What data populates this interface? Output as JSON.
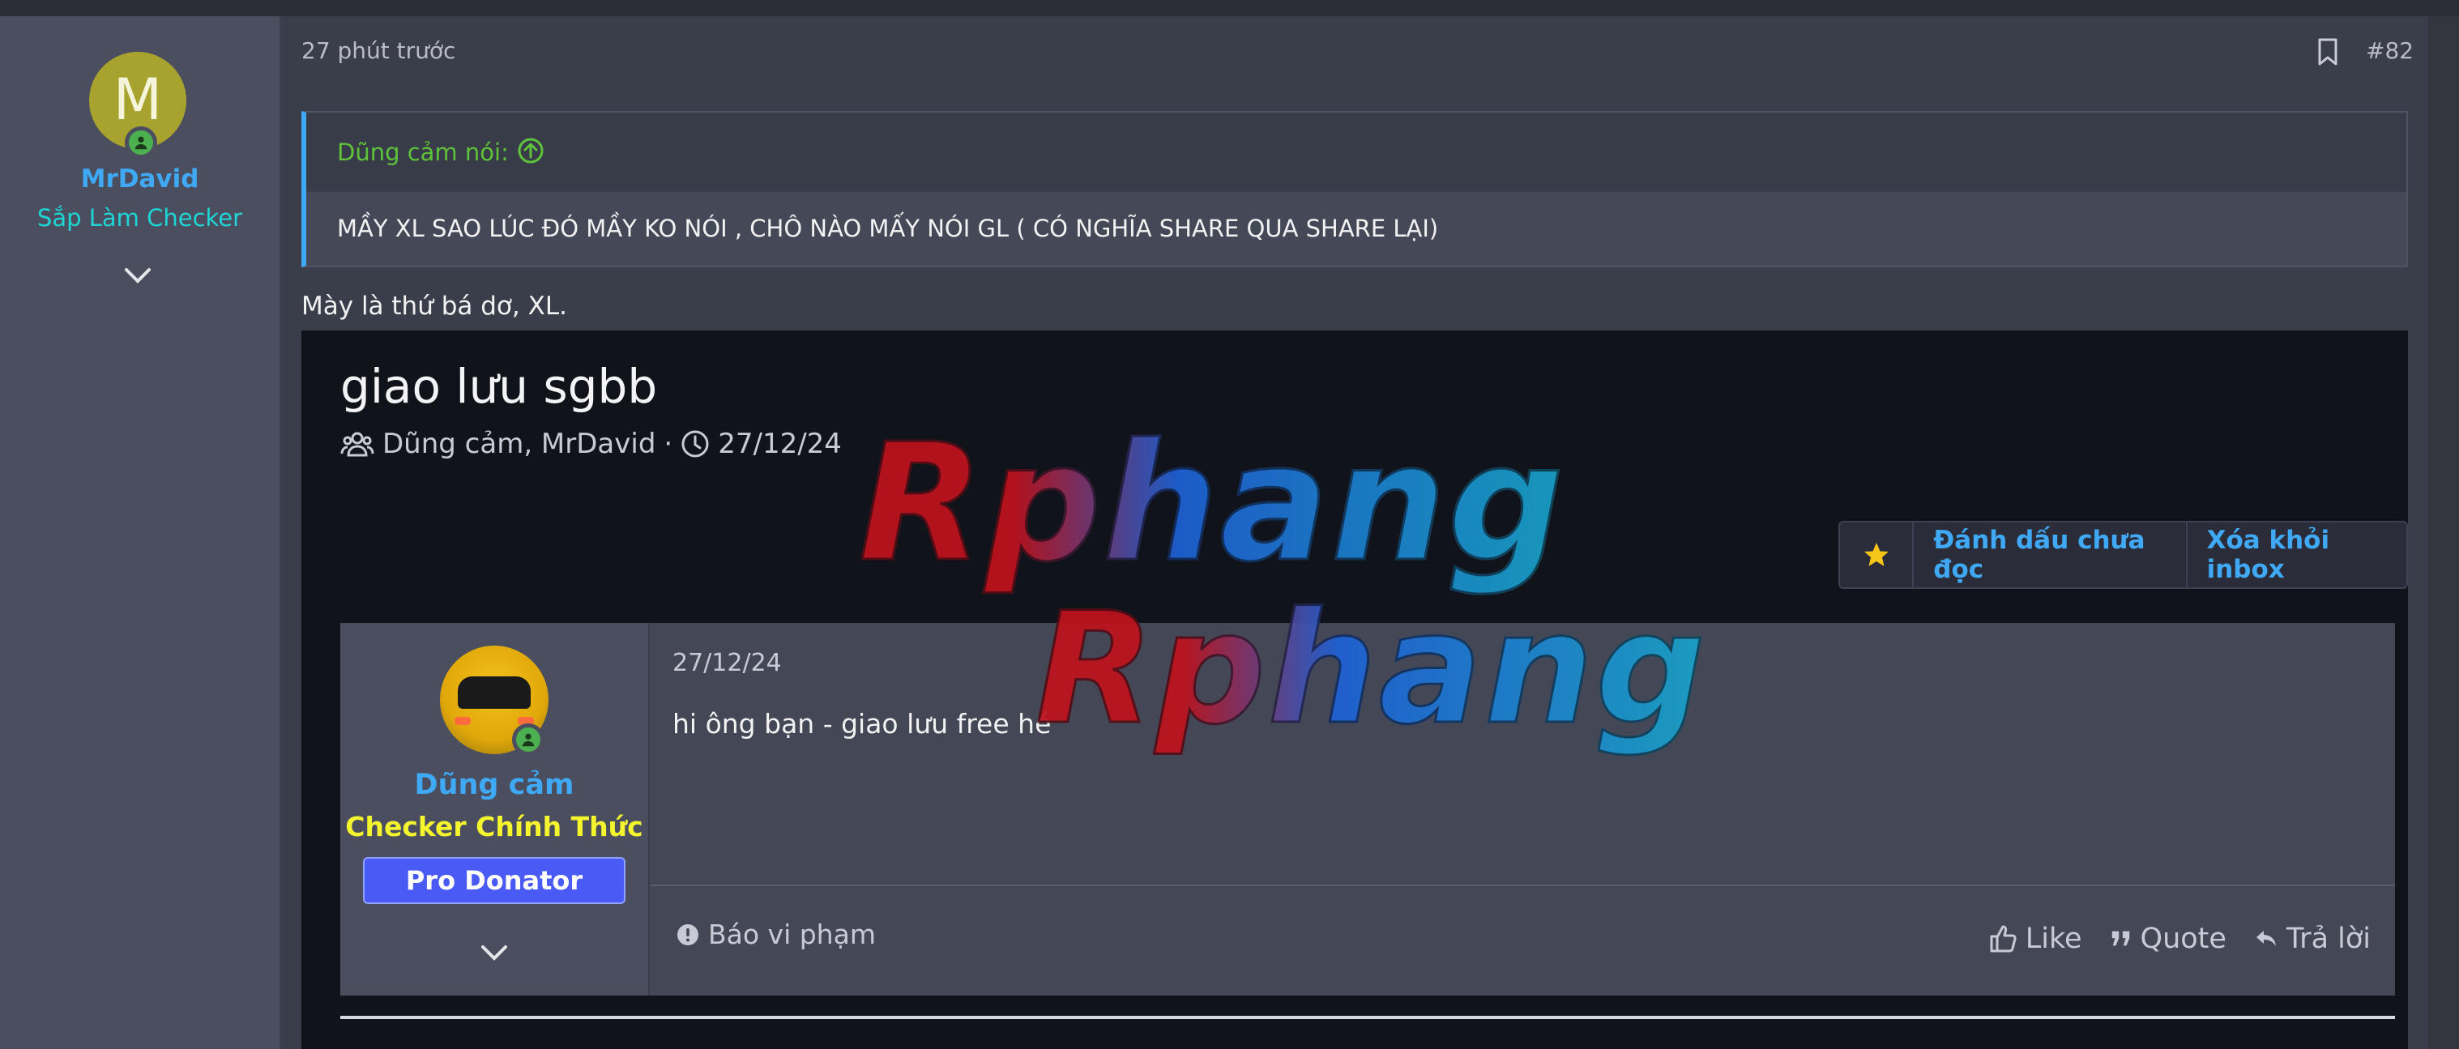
{
  "post": {
    "time": "27 phút trước",
    "number": "#82",
    "body_text": "Mày là thứ bá dơ, XL."
  },
  "author": {
    "avatar_letter": "M",
    "name": "MrDavid",
    "title": "Sắp Làm Checker"
  },
  "quote": {
    "header": "Dũng cảm nói:",
    "text": "MẦY XL SAO LÚC ĐÓ MẦY KO NÓI , CHÔ NÀO MẤY NÓI GL ( CÓ NGHĨA SHARE QUA SHARE LẠI)"
  },
  "embed": {
    "title": "giao lưu sgbb",
    "participants": "Dũng cảm, MrDavid",
    "separator": "·",
    "date": "27/12/24",
    "buttons": {
      "mark_unread": "Đánh dấu chưa đọc",
      "remove_inbox": "Xóa khỏi inbox"
    },
    "message": {
      "author_name": "Dũng cảm",
      "author_title": "Checker Chính Thức",
      "badge": "Pro Donator",
      "date": "27/12/24",
      "text": "hi ông bạn - giao lưu free hé",
      "report": "Báo vi phạm",
      "like": "Like",
      "quote": "Quote",
      "reply": "Trả lời"
    }
  },
  "watermark": {
    "line1": "Rphang",
    "line2": "Rphang"
  },
  "colors": {
    "accent_blue": "#3fa9f5",
    "online_green": "#4caf50",
    "quote_green": "#5ec23a",
    "title_yellow": "#f5f52e",
    "badge_blue": "#4a5af5"
  }
}
